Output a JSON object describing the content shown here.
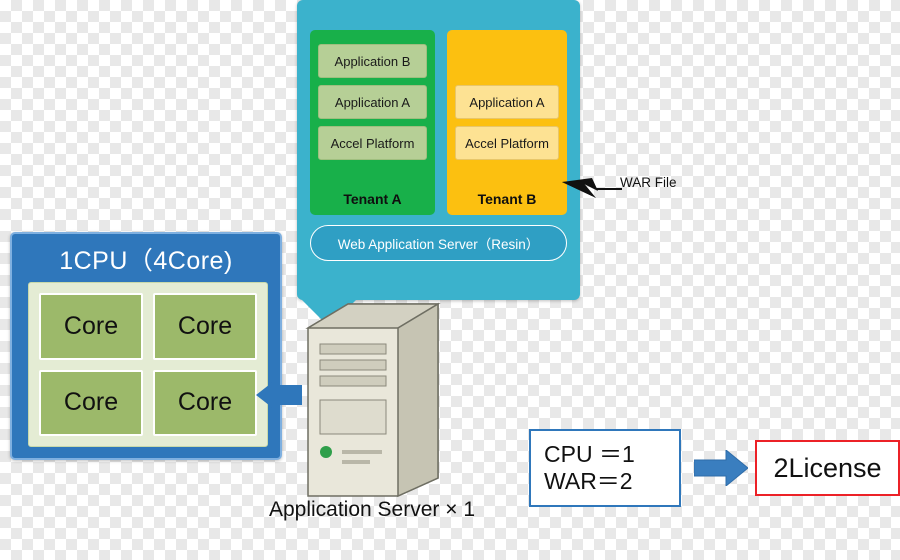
{
  "diagram": {
    "title": "Application Server licensing diagram",
    "colors": {
      "teal_panel": "#3bb2cc",
      "tenant_a": "#18b04a",
      "tenant_b": "#fcc010",
      "cpu_panel": "#2f77bb",
      "core_fill": "#9cb96a",
      "license_border": "#ec2127",
      "arrow_blue": "#2f77bb"
    }
  },
  "server_panel": {
    "tenant_a": {
      "label": "Tenant A",
      "boxes": [
        "Application B",
        "Application A",
        "Accel Platform"
      ]
    },
    "tenant_b": {
      "label": "Tenant B",
      "boxes": [
        "Application A",
        "Accel Platform"
      ]
    },
    "web_application_server": "Web Application Server（Resin）"
  },
  "callout": {
    "war_file": "WAR File"
  },
  "cpu_panel": {
    "title": "1CPU（4Core)",
    "cores": [
      "Core",
      "Core",
      "Core",
      "Core"
    ]
  },
  "server": {
    "caption": "Application Server × 1"
  },
  "summary": {
    "cpu_line": "CPU ＝1",
    "war_line": "WAR＝2",
    "license": "2License"
  }
}
